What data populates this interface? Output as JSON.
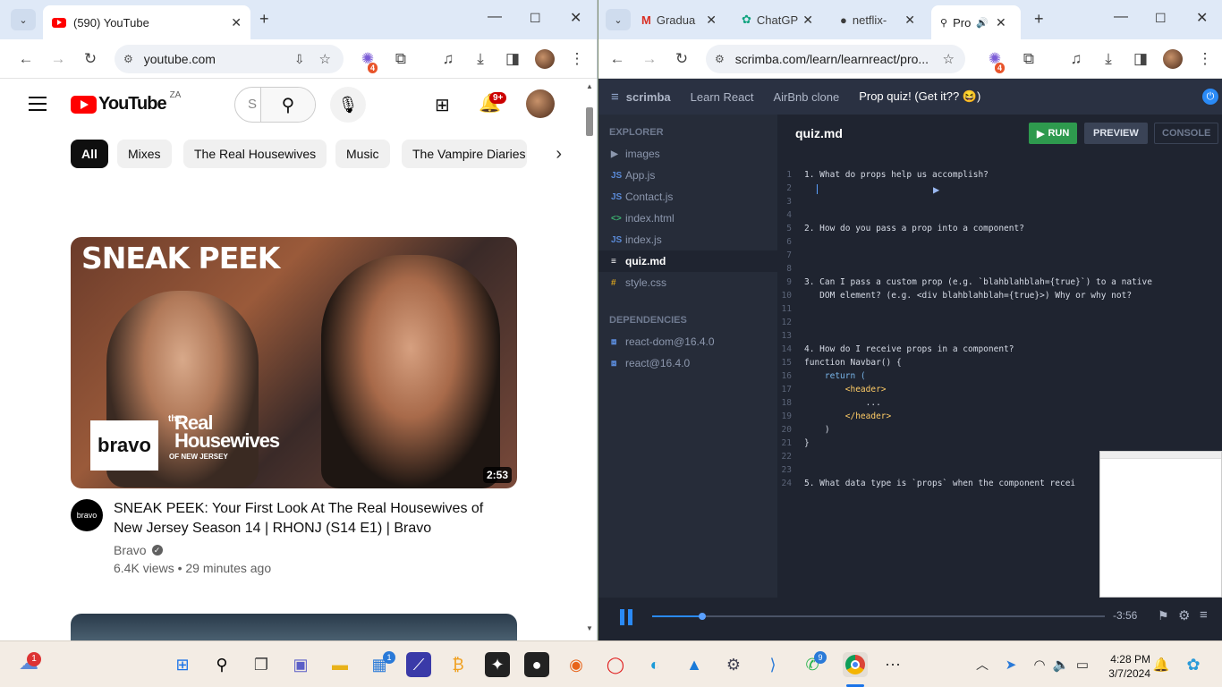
{
  "left": {
    "tab_title": "(590) YouTube",
    "url": "youtube.com",
    "ext_badge": "4",
    "yt": {
      "logo_text": "YouTube",
      "region": "ZA",
      "search_placeholder": "S",
      "notif_count": "9+",
      "chips": [
        "All",
        "Mixes",
        "The Real Housewives",
        "Music",
        "The Vampire Diaries"
      ],
      "video": {
        "thumb_title": "SNEAK PEEK",
        "thumb_brand": "bravo",
        "thumb_show_small": "the",
        "thumb_show": "Real Housewives",
        "thumb_show_sub": "OF NEW JERSEY",
        "duration": "2:53",
        "title": "SNEAK PEEK: Your First Look At The Real Housewives of New Jersey Season 14 | RHONJ (S14 E1) | Bravo",
        "channel": "Bravo",
        "channel_avatar": "bravo",
        "meta": "6.4K views • 29 minutes ago"
      }
    }
  },
  "right": {
    "tabs": [
      "Gradua",
      "ChatGP",
      "netflix-",
      "Pro"
    ],
    "url": "scimba.com/learn/learnreact/pro...",
    "url_full": "scrimba.com/learn/learnreact/pro...",
    "ext_badge": "4",
    "scrimba": {
      "logo": "scrimba",
      "crumbs": [
        "Learn React",
        "AirBnb clone",
        "Prop quiz! (Get it?? 😆)"
      ],
      "explorer_label": "EXPLORER",
      "files": [
        {
          "icon": "▶",
          "name": "images",
          "color": "#8c97ad"
        },
        {
          "icon": "JS",
          "name": "App.js",
          "color": "#5a8ad8"
        },
        {
          "icon": "JS",
          "name": "Contact.js",
          "color": "#5a8ad8"
        },
        {
          "icon": "<>",
          "name": "index.html",
          "color": "#3cb371"
        },
        {
          "icon": "JS",
          "name": "index.js",
          "color": "#5a8ad8"
        },
        {
          "icon": "≡",
          "name": "quiz.md",
          "color": "#ffffff"
        },
        {
          "icon": "#",
          "name": "style.css",
          "color": "#d4a020"
        }
      ],
      "deps_label": "DEPENDENCIES",
      "deps": [
        "react-dom@16.4.0",
        "react@16.4.0"
      ],
      "filename": "quiz.md",
      "run": "RUN",
      "preview": "PREVIEW",
      "console": "CONSOLE",
      "lines": [
        {
          "n": "1",
          "t": "1. What do props help us accomplish?"
        },
        {
          "n": "2",
          "t": ""
        },
        {
          "n": "3",
          "t": ""
        },
        {
          "n": "4",
          "t": ""
        },
        {
          "n": "5",
          "t": "2. How do you pass a prop into a component?"
        },
        {
          "n": "6",
          "t": ""
        },
        {
          "n": "7",
          "t": ""
        },
        {
          "n": "8",
          "t": ""
        },
        {
          "n": "9",
          "t": "3. Can I pass a custom prop (e.g. `blahblahblah={true}`) to a native"
        },
        {
          "n": "10",
          "t": "   DOM element? (e.g. <div blahblahblah={true}>) Why or why not?"
        },
        {
          "n": "11",
          "t": ""
        },
        {
          "n": "12",
          "t": ""
        },
        {
          "n": "13",
          "t": ""
        },
        {
          "n": "14",
          "t": "4. How do I receive props in a component?"
        },
        {
          "n": "15",
          "t": "function Navbar() {"
        },
        {
          "n": "16",
          "t": "    return ("
        },
        {
          "n": "17",
          "t": "        <header>"
        },
        {
          "n": "18",
          "t": "            ..."
        },
        {
          "n": "19",
          "t": "        </header>"
        },
        {
          "n": "20",
          "t": "    )"
        },
        {
          "n": "21",
          "t": "}"
        },
        {
          "n": "22",
          "t": ""
        },
        {
          "n": "23",
          "t": ""
        },
        {
          "n": "24",
          "t": "5. What data type is `props` when the component recei"
        }
      ],
      "time": "-3:56",
      "progress": 0.11
    }
  },
  "taskbar": {
    "weather_badge": "1",
    "store_badge": "1",
    "whatsapp_badge": "9",
    "time": "4:28 PM",
    "date": "3/7/2024"
  }
}
